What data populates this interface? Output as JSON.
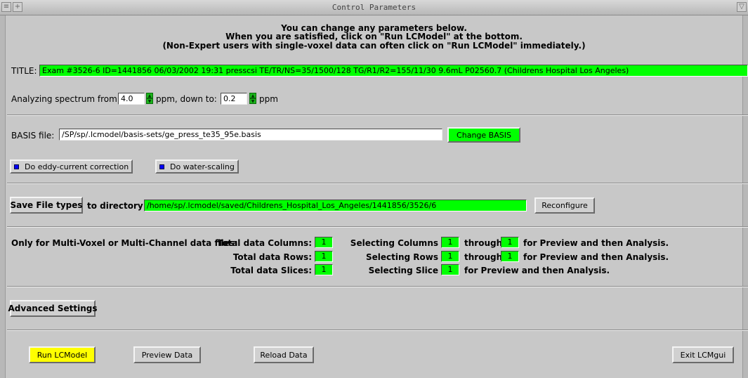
{
  "window": {
    "title": "Control Parameters"
  },
  "intro": {
    "line1": "You can change any parameters below.",
    "line2": "When you are satisfied, click on \"Run LCModel\" at the bottom.",
    "line3": "(Non-Expert users with single-voxel data can often click on \"Run LCModel\" immediately.)"
  },
  "title_row": {
    "label": "TITLE:",
    "value": "Exam #3526-6  ID=1441856  06/03/2002 19:31  presscsi  TE/TR/NS=35/1500/128  TG/R1/R2=155/11/30  9.6mL  P02560.7  (Childrens Hospital Los Angeles)"
  },
  "ppm": {
    "label_from": "Analyzing spectrum from:",
    "from_value": "4.0",
    "label_down": "ppm, down to:",
    "down_value": "0.2",
    "label_unit": "ppm"
  },
  "basis": {
    "label": "BASIS file:",
    "value": "/SP/sp/.lcmodel/basis-sets/ge_press_te35_95e.basis",
    "change_label": "Change BASIS"
  },
  "options": {
    "eddy_label": "Do eddy-current correction",
    "water_label": "Do water-scaling"
  },
  "save": {
    "button_label": "Save File types",
    "dir_label": "to directory:",
    "dir_value": "/home/sp/.lcmodel/saved/Childrens_Hospital_Los_Angeles/1441856/3526/6",
    "reconfigure_label": "Reconfigure"
  },
  "multivoxel": {
    "heading": "Only for Multi-Voxel or Multi-Channel data files:",
    "total_columns_label": "Total data Columns:",
    "total_columns": "1",
    "total_rows_label": "Total data Rows:",
    "total_rows": "1",
    "total_slices_label": "Total data Slices:",
    "total_slices": "1",
    "sel_columns_label": "Selecting Columns",
    "sel_columns_from": "1",
    "sel_columns_through_label": "through",
    "sel_columns_to": "1",
    "sel_columns_suffix": "for Preview and then Analysis.",
    "sel_rows_label": "Selecting Rows",
    "sel_rows_from": "1",
    "sel_rows_through_label": "through",
    "sel_rows_to": "1",
    "sel_rows_suffix": "for Preview and then Analysis.",
    "sel_slice_label": "Selecting Slice",
    "sel_slice": "1",
    "sel_slice_suffix": "for Preview and then Analysis."
  },
  "advanced": {
    "label": "Advanced Settings"
  },
  "actions": {
    "run_label": "Run LCModel",
    "preview_label": "Preview Data",
    "reload_label": "Reload Data",
    "exit_label": "Exit LCMgui"
  },
  "colors": {
    "field_green": "#00ff00",
    "run_yellow": "#ffff00",
    "check_blue": "#0000ff",
    "background": "#c8c8c8"
  }
}
